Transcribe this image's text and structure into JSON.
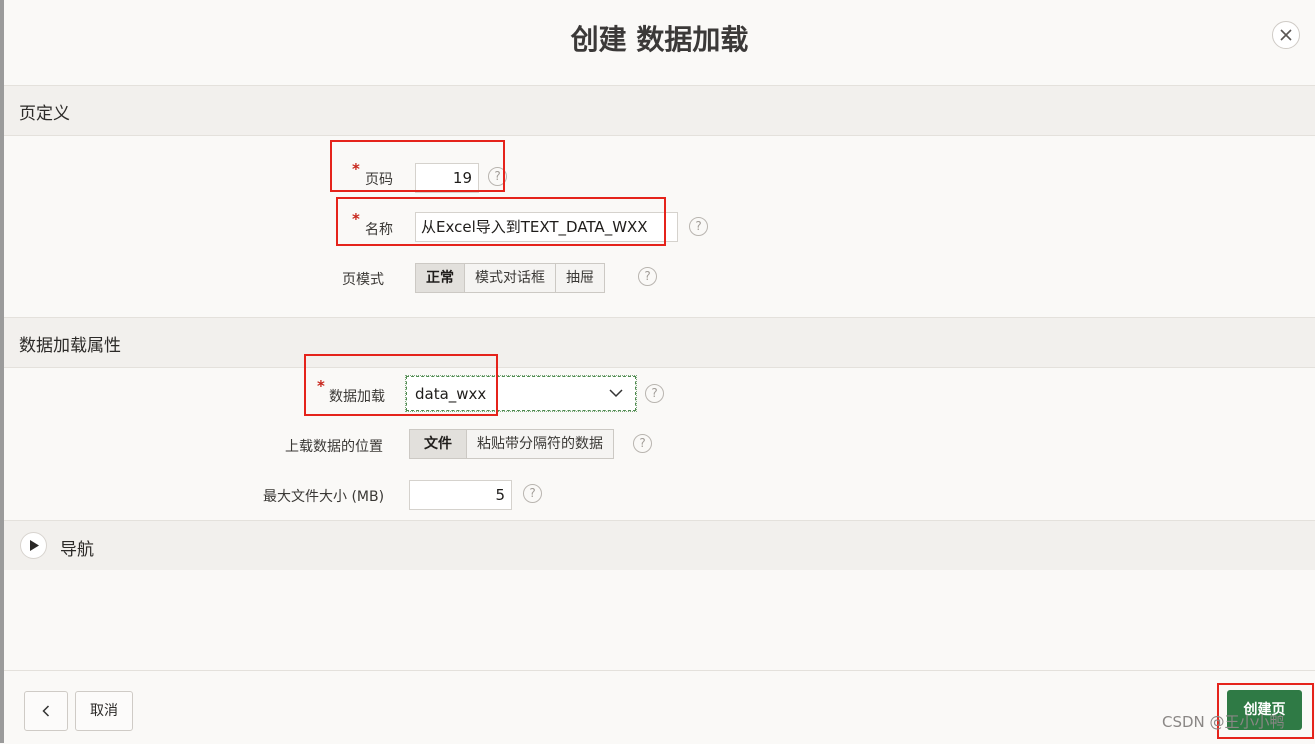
{
  "dialog": {
    "title": "创建 数据加载",
    "close_icon": "close-icon"
  },
  "page_definition": {
    "section_title": "页定义",
    "page_number_label": "页码",
    "page_number_value": "19",
    "name_label": "名称",
    "name_value": "从Excel导入到TEXT_DATA_WXX",
    "page_mode_label": "页模式",
    "page_mode_options": [
      "正常",
      "模式对话框",
      "抽屉"
    ],
    "page_mode_selected": "正常"
  },
  "data_load_attributes": {
    "section_title": "数据加载属性",
    "data_load_label": "数据加载",
    "data_load_value": "data_wxx",
    "upload_location_label": "上载数据的位置",
    "upload_location_options": [
      "文件",
      "粘贴带分隔符的数据"
    ],
    "upload_location_selected": "文件",
    "max_file_size_label": "最大文件大小 (MB)",
    "max_file_size_value": "5"
  },
  "navigation": {
    "section_title": "导航"
  },
  "footer": {
    "back_label": "<",
    "cancel_label": "取消",
    "create_label": "创建页"
  },
  "help_glyph": "?",
  "required_mark": "*",
  "watermark": "CSDN @王小小鸭",
  "colors": {
    "primary": "#2f7a45",
    "required": "#c7251b",
    "highlight": "#e5231b"
  }
}
